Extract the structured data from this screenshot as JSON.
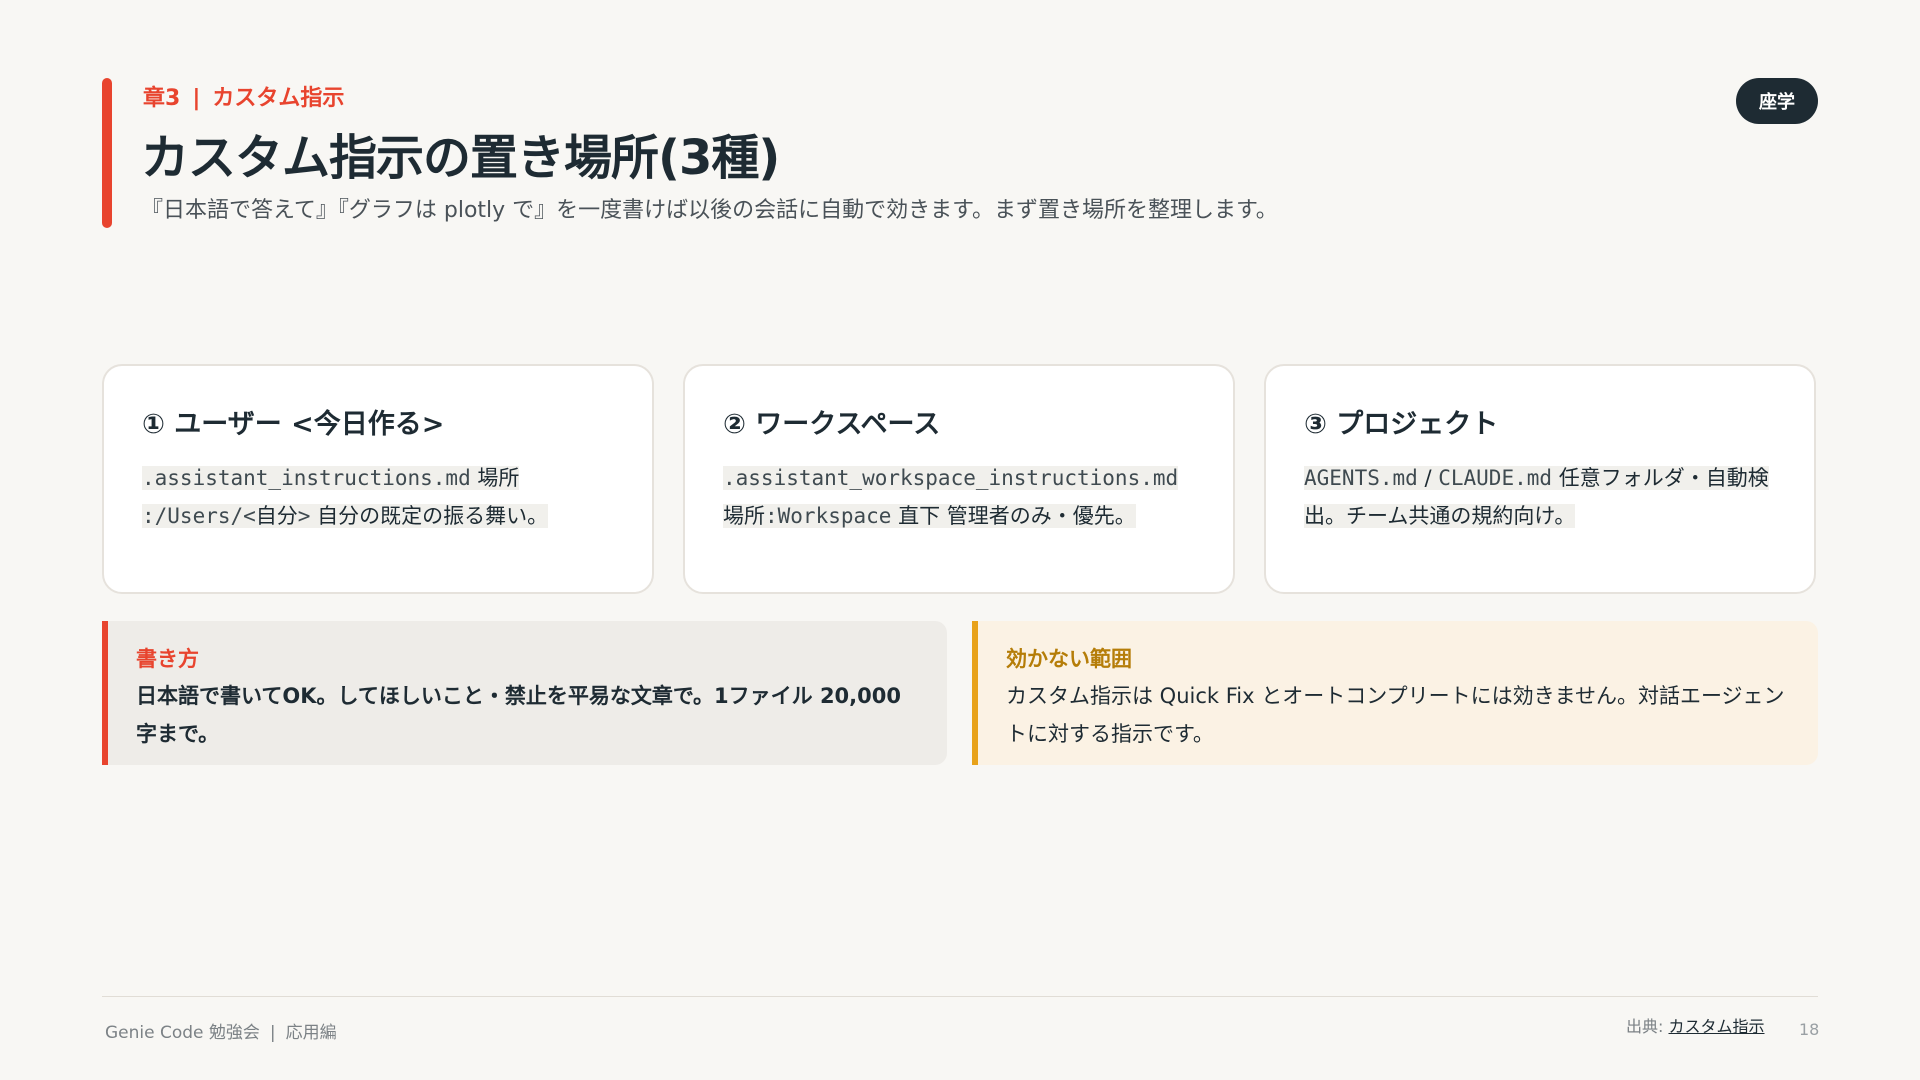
{
  "header": {
    "chapter_label": "章3",
    "chapter_separator": "|",
    "chapter_topic": "カスタム指示",
    "title": "カスタム指示の置き場所(3種)",
    "subtitle": "『日本語で答えて』『グラフは plotly で』を一度書けば以後の会話に自動で効きます。まず置き場所を整理します。",
    "badge": "座学"
  },
  "cards": [
    {
      "heading": "① ユーザー <今日作る>",
      "code1": ".assistant_instructions.md",
      "text1": " 場所",
      "code2": ":/Users/<",
      "text2": "自分",
      "code3": ">",
      "text3": " 自分の既定の振る舞い。"
    },
    {
      "heading": "② ワークスペース",
      "code1": ".assistant_workspace_instructions.md",
      "text1": " 場所",
      "code2": ":Workspace",
      "text2": " 直下 管理者のみ・優先。"
    },
    {
      "heading": "③ プロジェクト",
      "code1": "AGENTS.md",
      "text1": " / ",
      "code2": "CLAUDE.md",
      "text2": " 任意フォルダ・自動検出。チーム共通の規約向け。"
    }
  ],
  "notes": {
    "left": {
      "heading": "書き方",
      "body": "日本語で書いてOK。してほしいこと・禁止を平易な文章で。1ファイル 20,000 字まで。"
    },
    "right": {
      "heading": "効かない範囲",
      "body": "カスタム指示は Quick Fix とオートコンプリートには効きません。対話エージェントに対する指示です。"
    }
  },
  "footer": {
    "left_main": "Genie Code 勉強会",
    "left_separator": "|",
    "left_sub": "応用編",
    "source_label": "出典: ",
    "source_link": "カスタム指示",
    "page_number": "18"
  },
  "colors": {
    "accent": "#e8442e",
    "navy": "#1e2b33",
    "warning": "#e8a21a",
    "background": "#f8f7f4"
  }
}
